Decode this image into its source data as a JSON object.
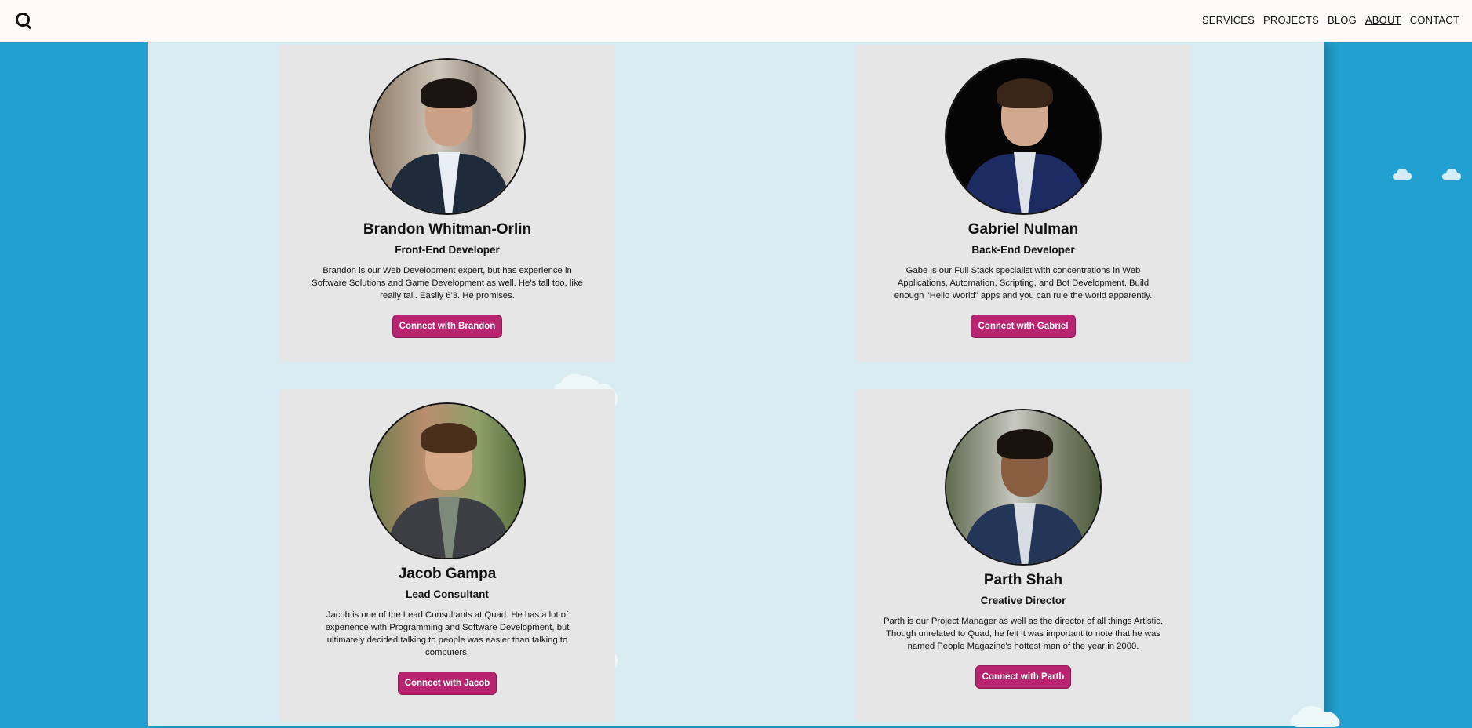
{
  "nav": {
    "logo_icon": "quad-logo-icon",
    "links": [
      {
        "label": "SERVICES"
      },
      {
        "label": "PROJECTS"
      },
      {
        "label": "BLOG"
      },
      {
        "label": "ABOUT",
        "active": true
      },
      {
        "label": "CONTACT"
      }
    ]
  },
  "colors": {
    "page_bg": "#22a0cf",
    "panel_bg": "#d9ecf2",
    "card_bg": "#e6e6e6",
    "button_bg": "#b8246f",
    "button_text": "#ffffff"
  },
  "team": [
    {
      "name": "Brandon Whitman-Orlin",
      "role": "Front-End Developer",
      "bio": "Brandon is our Web Development expert, but has experience in Software Solutions and Game Development as well. He's tall too, like really tall. Easily 6'3. He promises.",
      "button": "Connect with Brandon"
    },
    {
      "name": "Gabriel Nulman",
      "role": "Back-End Developer",
      "bio": "Gabe is our Full Stack specialist with concentrations in Web Applications, Automation, Scripting, and Bot Development. Build enough \"Hello World\" apps and you can rule the world apparently.",
      "button": "Connect with Gabriel"
    },
    {
      "name": "Jacob Gampa",
      "role": "Lead Consultant",
      "bio": "Jacob is one of the Lead Consultants at Quad. He has a lot of experience with Programming and Software Development, but ultimately decided talking to people was easier than talking to computers.",
      "button": "Connect with Jacob"
    },
    {
      "name": "Parth Shah",
      "role": "Creative Director",
      "bio": "Parth is our Project Manager as well as the director of all things Artistic. Though unrelated to Quad, he felt it was important to note that he was named People Magazine's hottest man of the year in 2000.",
      "button": "Connect with Parth"
    }
  ]
}
